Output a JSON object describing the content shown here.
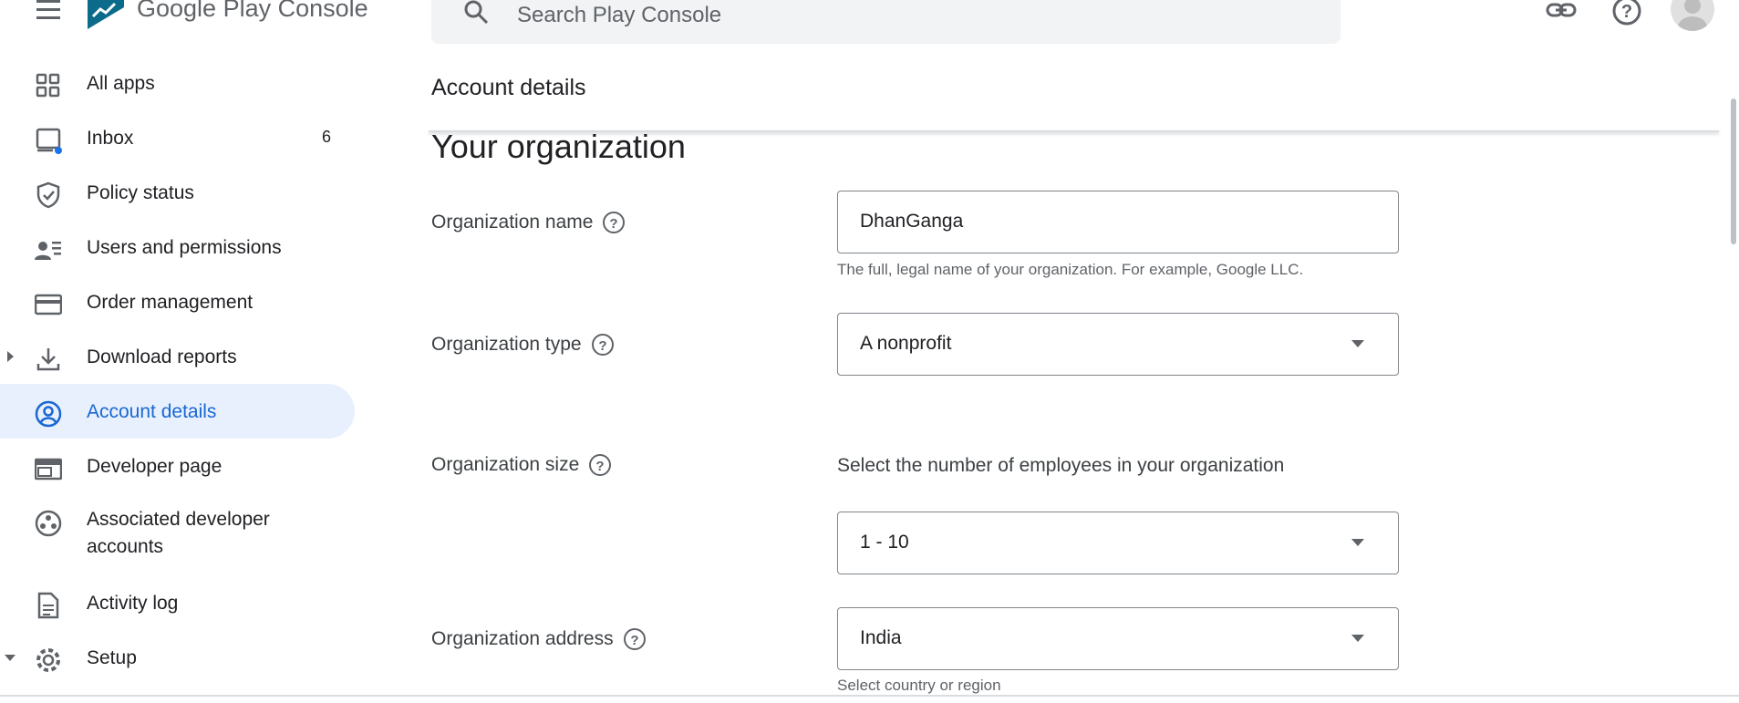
{
  "app": {
    "logo_text": "Google Play Console"
  },
  "search": {
    "placeholder": "Search Play Console"
  },
  "top_icons": [
    "link-icon",
    "help-icon",
    "account-avatar"
  ],
  "sidebar": {
    "items": [
      {
        "label": "All apps",
        "icon": "grid-icon"
      },
      {
        "label": "Inbox",
        "icon": "inbox-icon",
        "badge": "6"
      },
      {
        "label": "Policy status",
        "icon": "shield-icon"
      },
      {
        "label": "Users and permissions",
        "icon": "users-icon"
      },
      {
        "label": "Order management",
        "icon": "card-icon"
      },
      {
        "label": "Download reports",
        "icon": "download-icon"
      },
      {
        "label": "Account details",
        "icon": "account-circle-icon",
        "active": true
      },
      {
        "label": "Developer page",
        "icon": "web-icon"
      },
      {
        "label": "Associated developer accounts",
        "label_line1": "Associated developer",
        "label_line2": "accounts",
        "icon": "group-circle-icon"
      },
      {
        "label": "Activity log",
        "icon": "document-icon"
      },
      {
        "label": "Setup",
        "icon": "gear-icon"
      }
    ]
  },
  "main": {
    "page_title": "Account details",
    "section_title": "Your organization",
    "fields": {
      "org_name": {
        "label": "Organization name",
        "value": "DhanGanga",
        "hint": "The full, legal name of your organization. For example, Google LLC."
      },
      "org_type": {
        "label": "Organization type",
        "value": "A nonprofit"
      },
      "org_size": {
        "label": "Organization size",
        "description": "Select the number of employees in your organization",
        "value": "1 - 10"
      },
      "org_address": {
        "label": "Organization address",
        "value": "India",
        "hint": "Select country or region"
      }
    }
  },
  "colors": {
    "accent": "#1967d2",
    "active_bg": "#e8f0fe",
    "badge_dot": "#1a73e8"
  }
}
